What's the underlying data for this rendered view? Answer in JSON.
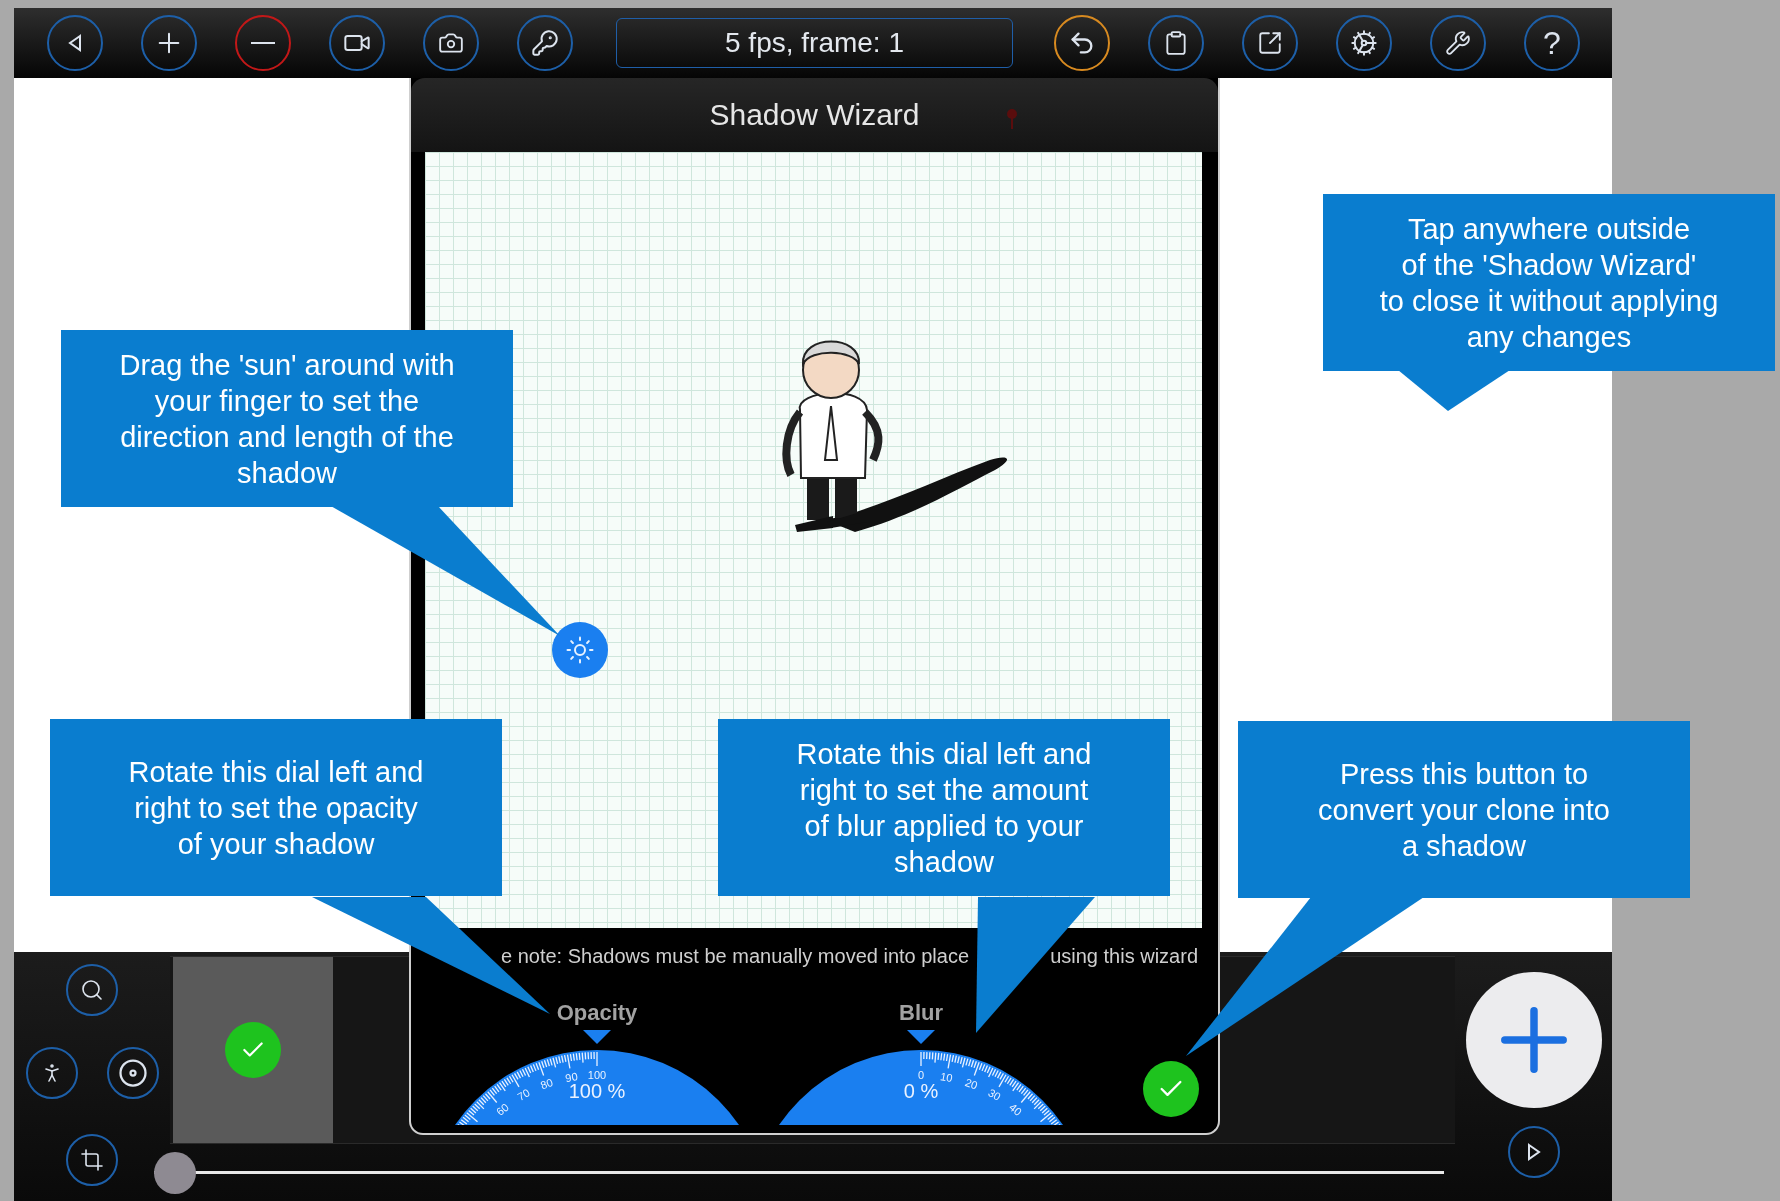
{
  "toolbar": {
    "frame_info": "5 fps, frame: 1",
    "help_label": "?"
  },
  "wizard": {
    "title": "Shadow Wizard",
    "note_parts": [
      "e note: Shadows must be manually moved into place",
      "using this wizard"
    ],
    "dials": [
      {
        "label": "Opacity",
        "reading": "100 %",
        "kind": "leftward",
        "ticks": [
          "100",
          "90",
          "80",
          "70",
          "60"
        ]
      },
      {
        "label": "Blur",
        "reading": "0 %",
        "kind": "rightward",
        "ticks": [
          "0",
          "10",
          "20",
          "30",
          "40"
        ]
      }
    ]
  },
  "callouts": [
    {
      "lines": [
        "Drag the 'sun' around with",
        "your finger to set the",
        "direction and length of the",
        "shadow"
      ]
    },
    {
      "lines": [
        "Tap anywhere outside",
        "of the 'Shadow Wizard'",
        "to close it without applying",
        "any changes"
      ]
    },
    {
      "lines": [
        "Rotate this dial left and",
        "right to set the opacity",
        "of your shadow"
      ]
    },
    {
      "lines": [
        "Rotate this dial left and",
        "right to set the amount",
        "of blur applied to your",
        "shadow"
      ]
    },
    {
      "lines": [
        "Press this button to",
        "convert your clone into",
        "a shadow"
      ]
    }
  ],
  "timeline": {
    "level": 0
  }
}
